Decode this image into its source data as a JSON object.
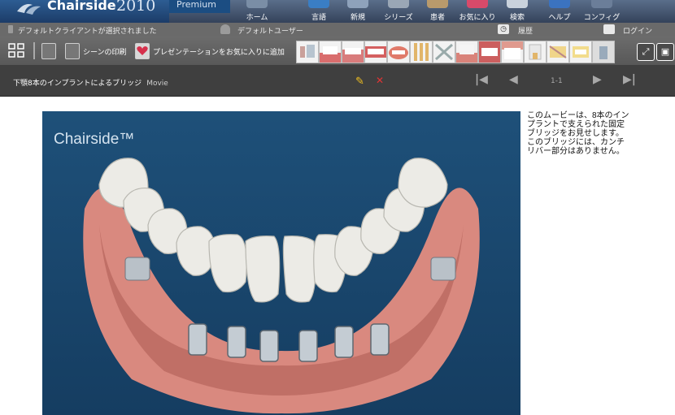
{
  "app": {
    "name": "Chairside",
    "year": "2010",
    "edition": "Premium"
  },
  "nav": [
    {
      "label": "ホーム",
      "icon": "home-icon"
    },
    {
      "label": "言語",
      "icon": "language-icon"
    },
    {
      "label": "新規",
      "icon": "new-icon"
    },
    {
      "label": "シリーズ",
      "icon": "series-icon"
    },
    {
      "label": "患者",
      "icon": "patient-icon"
    },
    {
      "label": "お気に入り",
      "icon": "favorites-icon"
    },
    {
      "label": "検索",
      "icon": "search-icon"
    },
    {
      "label": "ヘルプ",
      "icon": "help-icon"
    },
    {
      "label": "コンフィグ",
      "icon": "config-icon"
    }
  ],
  "status": {
    "client": "デフォルトクライアントが選択されました",
    "user": "デフォルトユーザー",
    "history": "履歴",
    "login": "ログイン"
  },
  "toolbar": {
    "print_scene": "シーンの印刷",
    "add_favorite": "プレゼンテーションをお気に入りに追加"
  },
  "presentation": {
    "title": "下顎8本のインプラントによるブリッジ",
    "type": "Movie",
    "page": "1-1"
  },
  "video": {
    "watermark": "Chairside™"
  },
  "caption": "このムービーは、8本のインプラントで支えられた固定ブリッジをお見せします。このブリッジには、カンチリバー部分はありません。",
  "colors": {
    "accent": "#2d5d93",
    "gum": "#d9897f",
    "video_bg": "#1e5079"
  }
}
